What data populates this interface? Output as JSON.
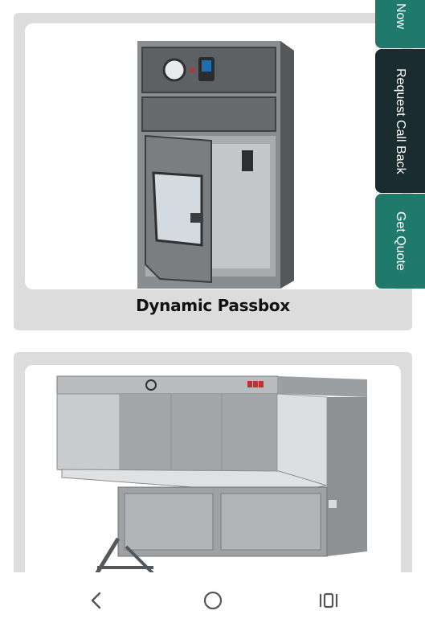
{
  "products": [
    {
      "title": "Dynamic Passbox",
      "image_icon": "passbox-image"
    },
    {
      "title": "",
      "image_icon": "laminar-flow-bench-image"
    }
  ],
  "side_actions": {
    "now_label": "Now",
    "callback_label": "Request Call Back",
    "quote_label": "Get Quote"
  },
  "colors": {
    "teal": "#1f7a6c",
    "dark": "#1b2c30",
    "card_bg": "#dcdcdc"
  },
  "navbar": {
    "back_icon": "chevron-left-icon",
    "home_icon": "circle-home-icon",
    "recents_icon": "recents-bars-icon"
  }
}
